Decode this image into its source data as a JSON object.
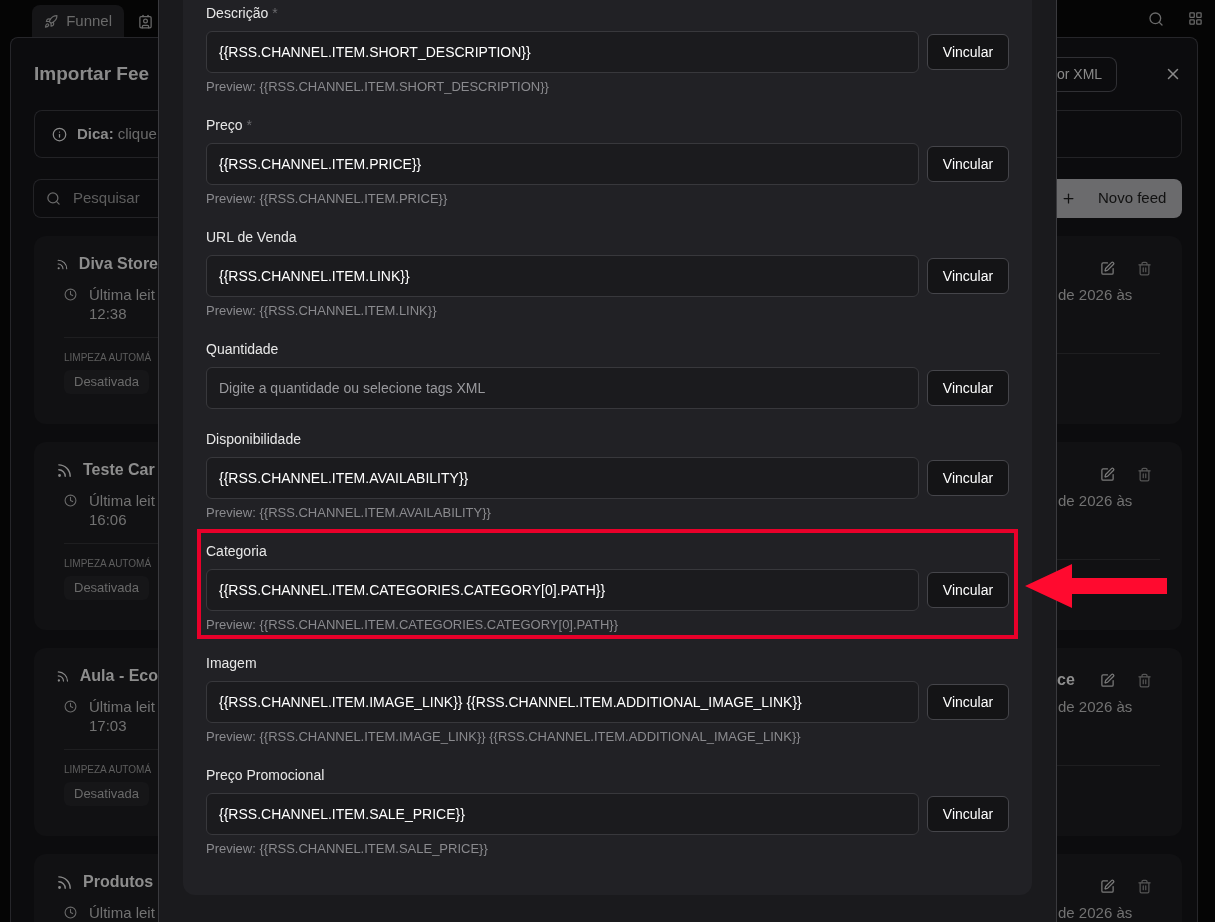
{
  "top_bar": {
    "tab": {
      "label": "Funnel"
    }
  },
  "background_panel": {
    "title": "Importar Fee",
    "tip": {
      "label": "Dica:",
      "text": "clique"
    },
    "xml_button": "or XML",
    "search": {
      "placeholder": "Pesquisar"
    },
    "new_button": "Novo feed",
    "feeds": [
      {
        "title": "Diva Store",
        "read_label": "Última leit",
        "time": "12:38",
        "date_tail": "de 2026 às",
        "cleanup": {
          "label": "LIMPEZA AUTOMÁ",
          "status": "Desativada"
        }
      },
      {
        "title": "Teste Car",
        "read_label": "Última leit",
        "time": "16:06",
        "date_tail": "de 2026 às",
        "cleanup": {
          "label": "LIMPEZA AUTOMÁ",
          "status": "Desativada"
        }
      },
      {
        "title": "Aula - Eco",
        "title_tail": "ce",
        "read_label": "Última leit",
        "time": "17:03",
        "date_tail": "de 2026 às",
        "cleanup": {
          "label": "LIMPEZA AUTOMÁ",
          "status": "Desativada"
        }
      },
      {
        "title": "Produtos",
        "read_label": "Última leit",
        "date_tail": "de 2026 às"
      }
    ]
  },
  "mapping": {
    "fields": [
      {
        "label": "Descrição",
        "marker": "*",
        "value": "{{RSS.CHANNEL.ITEM.SHORT_DESCRIPTION}}",
        "button": "Vincular",
        "preview": "Preview: {{RSS.CHANNEL.ITEM.SHORT_DESCRIPTION}}",
        "highlighted": false
      },
      {
        "label": "Preço",
        "marker": "*",
        "value": "{{RSS.CHANNEL.ITEM.PRICE}}",
        "button": "Vincular",
        "preview": "Preview: {{RSS.CHANNEL.ITEM.PRICE}}",
        "highlighted": false
      },
      {
        "label": "URL de Venda",
        "value": "{{RSS.CHANNEL.ITEM.LINK}}",
        "button": "Vincular",
        "preview": "Preview: {{RSS.CHANNEL.ITEM.LINK}}",
        "highlighted": false
      },
      {
        "label": "Quantidade",
        "placeholder": "Digite a quantidade ou selecione tags XML",
        "button": "Vincular",
        "highlighted": false
      },
      {
        "label": "Disponibilidade",
        "value": "{{RSS.CHANNEL.ITEM.AVAILABILITY}}",
        "button": "Vincular",
        "preview": "Preview: {{RSS.CHANNEL.ITEM.AVAILABILITY}}",
        "highlighted": false
      },
      {
        "label": "Categoria",
        "value": "{{RSS.CHANNEL.ITEM.CATEGORIES.CATEGORY[0].PATH}}",
        "button": "Vincular",
        "preview": "Preview: {{RSS.CHANNEL.ITEM.CATEGORIES.CATEGORY[0].PATH}}",
        "highlighted": true
      },
      {
        "label": "Imagem",
        "value": "{{RSS.CHANNEL.ITEM.IMAGE_LINK}} {{RSS.CHANNEL.ITEM.ADDITIONAL_IMAGE_LINK}}",
        "button": "Vincular",
        "preview": "Preview: {{RSS.CHANNEL.ITEM.IMAGE_LINK}} {{RSS.CHANNEL.ITEM.ADDITIONAL_IMAGE_LINK}}",
        "highlighted": false
      },
      {
        "label": "Preço Promocional",
        "value": "{{RSS.CHANNEL.ITEM.SALE_PRICE}}",
        "button": "Vincular",
        "preview": "Preview: {{RSS.CHANNEL.ITEM.SALE_PRICE}}",
        "highlighted": false
      }
    ]
  }
}
